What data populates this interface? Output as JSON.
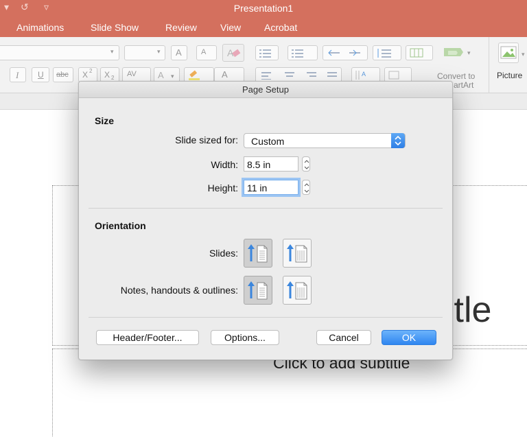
{
  "window": {
    "title": "Presentation1",
    "qat": {
      "undo_glyph": "▾",
      "redo_glyph": "↺",
      "customize_glyph": "▿"
    }
  },
  "ribbon": {
    "tabs": [
      {
        "label": "Animations"
      },
      {
        "label": "Slide Show"
      },
      {
        "label": "Review"
      },
      {
        "label": "View"
      },
      {
        "label": "Acrobat"
      }
    ],
    "font_controls": {
      "grow_font": "A",
      "shrink_font": "A",
      "italic": "I",
      "underline": "U",
      "strikethrough": "abc",
      "superscript": "X",
      "subscript": "X",
      "spacing": "AV",
      "font_color": "A"
    },
    "convert_label_line1": "Convert to",
    "convert_label_line2": "artArt",
    "picture_label": "Picture"
  },
  "slide": {
    "title_partial": "itle",
    "subtitle_placeholder": "Click to add subtitle"
  },
  "dialog": {
    "title": "Page Setup",
    "size": {
      "heading": "Size",
      "slide_sized_for_label": "Slide sized for:",
      "slide_sized_for_value": "Custom",
      "width_label": "Width:",
      "width_value": "8.5 in",
      "height_label": "Height:",
      "height_value": "11 in"
    },
    "orientation": {
      "heading": "Orientation",
      "slides_label": "Slides:",
      "notes_label": "Notes, handouts & outlines:",
      "slides_selected": "portrait",
      "notes_selected": "portrait"
    },
    "buttons": {
      "header_footer": "Header/Footer...",
      "options": "Options...",
      "cancel": "Cancel",
      "ok": "OK"
    }
  },
  "colors": {
    "titlebar": "#d4705e",
    "accent_blue": "#2f86f0",
    "arrow_blue": "#3b86dd"
  }
}
